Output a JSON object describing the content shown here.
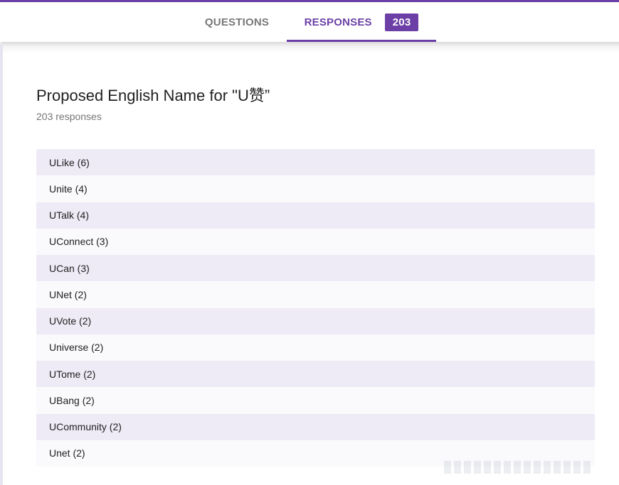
{
  "tabs": {
    "questions_label": "QUESTIONS",
    "responses_label": "RESPONSES",
    "responses_count": "203"
  },
  "question": {
    "title": "Proposed English Name for \"U赞”",
    "response_count_text": "203 responses"
  },
  "responses": [
    "ULike (6)",
    "Unite (4)",
    "UTalk (4)",
    "UConnect (3)",
    "UCan (3)",
    "UNet (2)",
    "UVote (2)",
    "Universe (2)",
    "UTome (2)",
    "UBang (2)",
    "UCommunity (2)",
    "Unet (2)"
  ],
  "colors": {
    "accent": "#6b3fa6",
    "row_alt": "#efebf6"
  }
}
